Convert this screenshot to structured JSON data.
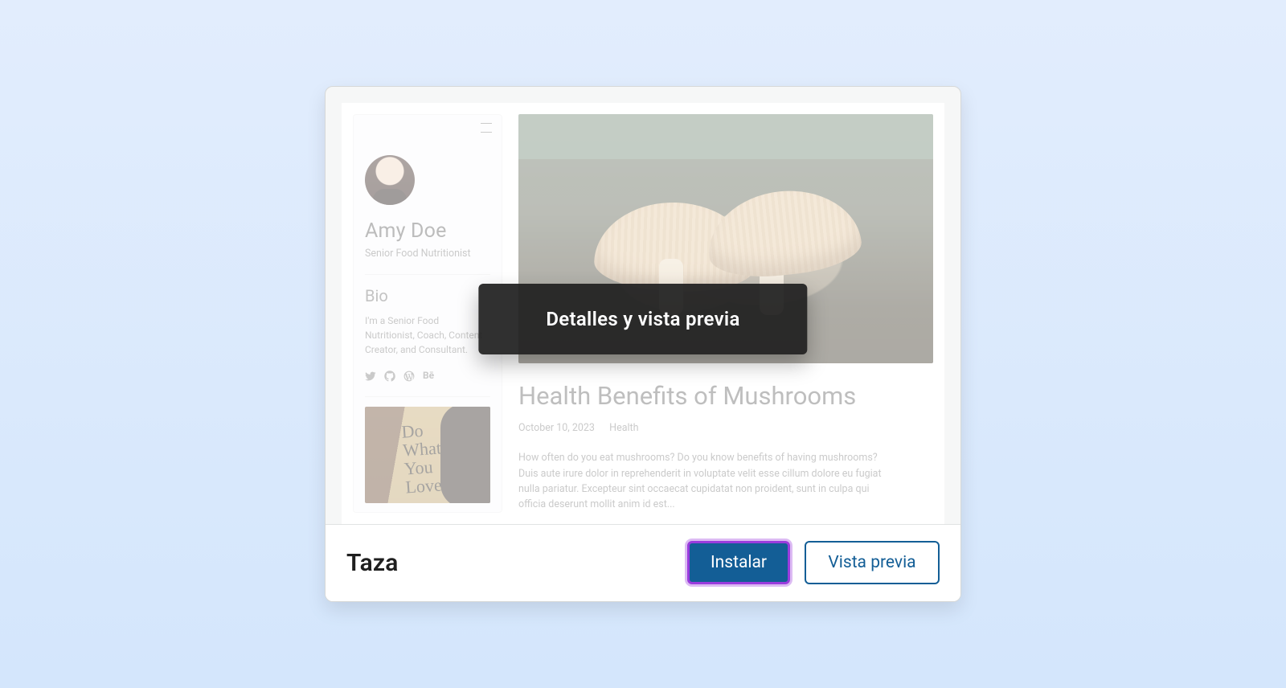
{
  "tooltip": {
    "label": "Detalles y vista previa"
  },
  "footer": {
    "theme_name": "Taza",
    "install_label": "Instalar",
    "preview_label": "Vista previa"
  },
  "preview": {
    "sidebar": {
      "name": "Amy Doe",
      "role": "Senior Food Nutritionist",
      "bio_heading": "Bio",
      "bio_text": "I'm a Senior Food Nutritionist, Coach, Content Creator, and Consultant.",
      "script_text": "Do\nWhat\nYou\nLove",
      "social_icons": [
        "twitter",
        "github",
        "wordpress",
        "behance"
      ]
    },
    "article": {
      "title": "Health Benefits of Mushrooms",
      "date": "October 10, 2023",
      "category": "Health",
      "summary": "How often do you eat mushrooms? Do you know benefits of having mushrooms? Duis aute irure dolor in reprehenderit in voluptate velit esse cillum dolore eu fugiat nulla pariatur. Excepteur sint occaecat cupidatat non proident, sunt in culpa qui officia deserunt mollit anim id est..."
    }
  }
}
